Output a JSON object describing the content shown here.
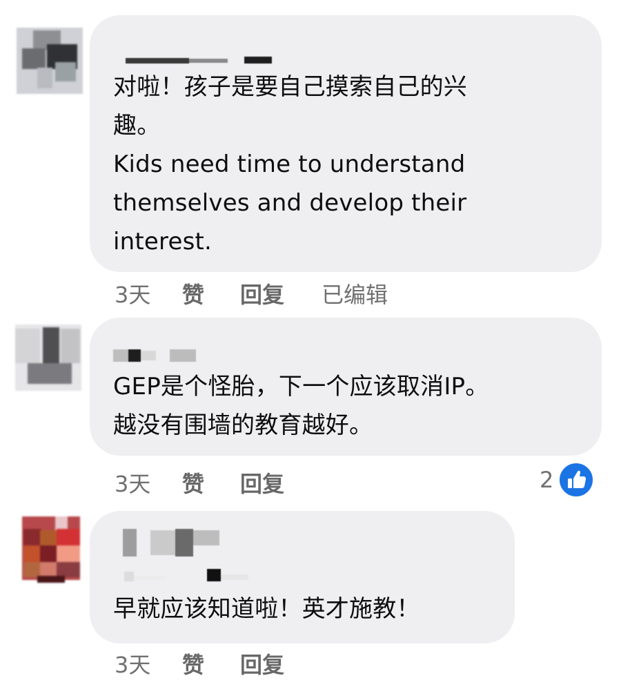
{
  "comments": [
    {
      "text": "对啦！孩子是要自己摸索自己的兴\n趣。\nKids need time to understand\nthemselves and develop their\ninterest.",
      "time": "3天",
      "like_label": "赞",
      "reply_label": "回复",
      "edited_label": "已编辑"
    },
    {
      "text": "GEP是个怪胎，下一个应该取消IP。\n越没有围墙的教育越好。",
      "time": "3天",
      "like_label": "赞",
      "reply_label": "回复",
      "reaction_count": "2",
      "reaction_icon": "like-thumb-icon"
    },
    {
      "text": "早就应该知道啦！英才施教！",
      "time": "3天",
      "like_label": "赞",
      "reply_label": "回复"
    }
  ],
  "colors": {
    "bubble": "#efeff2",
    "meta_text": "#707070",
    "like_blue": "#1b74e4"
  }
}
